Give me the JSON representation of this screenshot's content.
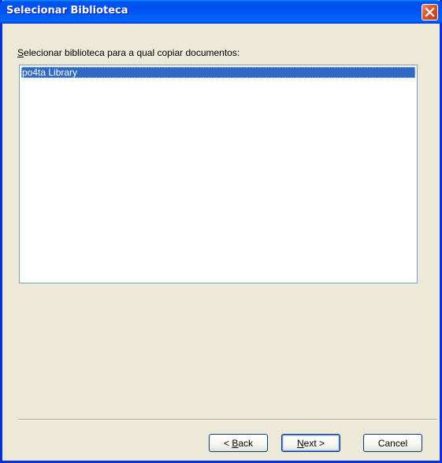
{
  "window": {
    "title": "Selecionar Biblioteca",
    "close_icon": "close-icon"
  },
  "prompt": {
    "accel_char": "S",
    "rest": "elecionar biblioteca para a qual copiar documentos:"
  },
  "libraries": {
    "items": [
      {
        "label": "po4ta Library",
        "selected": true
      }
    ]
  },
  "buttons": {
    "back": {
      "prefix": "< ",
      "accel": "B",
      "rest": "ack"
    },
    "next": {
      "accel": "N",
      "rest": "ext",
      "suffix": " >"
    },
    "cancel": {
      "label": "Cancel"
    }
  },
  "colors": {
    "title_bar": "#0053ee",
    "close_button": "#d8532d",
    "selection": "#316ac5",
    "dialog_face": "#ece9d8",
    "frame": "#0831d9"
  }
}
